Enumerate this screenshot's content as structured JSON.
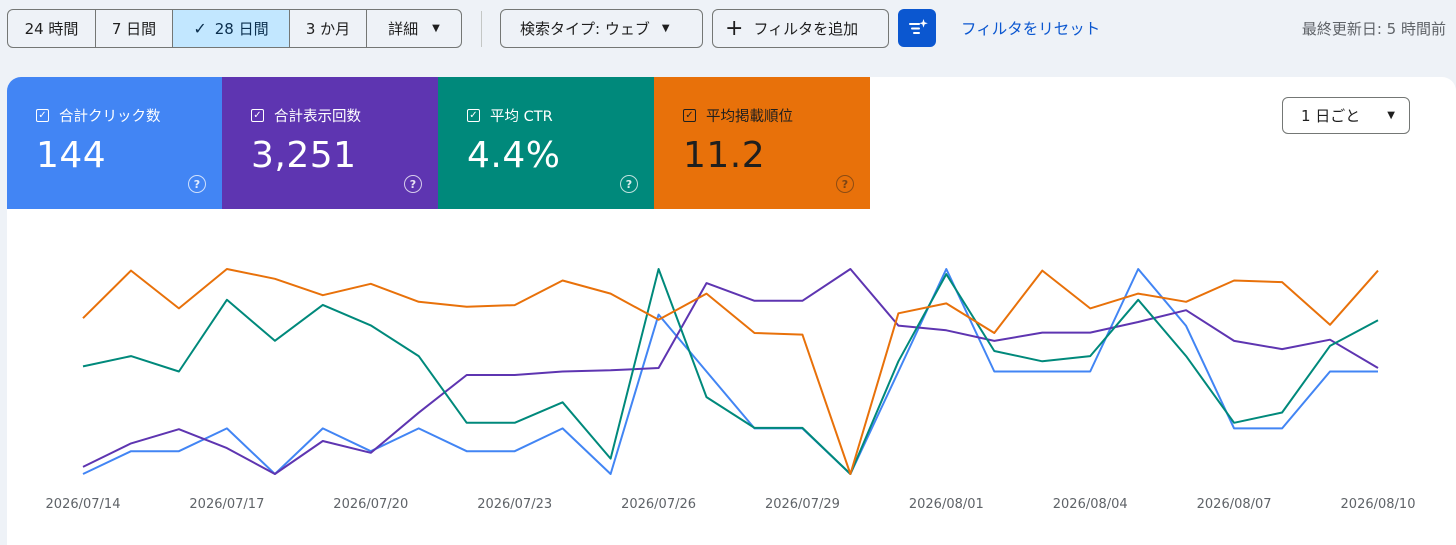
{
  "toolbar": {
    "range_buttons": [
      {
        "label": "24 時間",
        "active": false
      },
      {
        "label": "7 日間",
        "active": false
      },
      {
        "label": "28 日間",
        "active": true
      },
      {
        "label": "3 か月",
        "active": false
      },
      {
        "label": "詳細",
        "active": false
      }
    ],
    "search_type": "検索タイプ: ウェブ",
    "add_filter": "フィルタを追加",
    "reset_filters": "フィルタをリセット",
    "last_updated": "最終更新日: 5 時間前"
  },
  "metrics": [
    {
      "label": "合計クリック数",
      "value": "144",
      "color": "#4285f4",
      "checked": true
    },
    {
      "label": "合計表示回数",
      "value": "3,251",
      "color": "#5e35b1",
      "checked": true
    },
    {
      "label": "平均 CTR",
      "value": "4.4%",
      "color": "#00897b",
      "checked": true
    },
    {
      "label": "平均掲載順位",
      "value": "11.2",
      "color": "#e8710a",
      "checked": true
    }
  ],
  "granularity": {
    "label": "1 日ごと"
  },
  "chart_data": {
    "type": "line",
    "x_tick_labels": [
      "2026/07/14",
      "2026/07/17",
      "2026/07/20",
      "2026/07/23",
      "2026/07/26",
      "2026/07/29",
      "2026/08/01",
      "2026/08/04",
      "2026/08/07",
      "2026/08/10"
    ],
    "x": [
      "2026/07/14",
      "2026/07/15",
      "2026/07/16",
      "2026/07/17",
      "2026/07/18",
      "2026/07/19",
      "2026/07/20",
      "2026/07/21",
      "2026/07/22",
      "2026/07/23",
      "2026/07/24",
      "2026/07/25",
      "2026/07/26",
      "2026/07/27",
      "2026/07/28",
      "2026/07/29",
      "2026/07/30",
      "2026/07/31",
      "2026/08/01",
      "2026/08/02",
      "2026/08/03",
      "2026/08/04",
      "2026/08/05",
      "2026/08/06",
      "2026/08/07",
      "2026/08/08",
      "2026/08/09",
      "2026/08/10"
    ],
    "y_axis_visible": false,
    "grid": false,
    "legend": "none",
    "series": [
      {
        "name": "合計クリック数",
        "color": "#4285f4",
        "values": [
          1,
          3,
          3,
          5,
          1,
          5,
          3,
          5,
          3,
          3,
          5,
          1,
          15,
          10,
          5,
          5,
          1,
          10,
          19,
          10,
          10,
          10,
          19,
          14,
          5,
          5,
          10,
          10
        ]
      },
      {
        "name": "合計表示回数",
        "color": "#5e35b1",
        "values": [
          44,
          64,
          76,
          60,
          38,
          66,
          56,
          90,
          122,
          122,
          125,
          126,
          128,
          200,
          185,
          185,
          212,
          164,
          160,
          151,
          158,
          158,
          167,
          177,
          151,
          144,
          152,
          128
        ]
      },
      {
        "name": "平均 CTR",
        "color": "#00897b",
        "values": [
          2.3,
          2.5,
          2.2,
          3.6,
          2.8,
          3.5,
          3.1,
          2.5,
          1.2,
          1.2,
          1.6,
          0.5,
          4.2,
          1.7,
          1.1,
          1.1,
          0.2,
          2.4,
          4.1,
          2.6,
          2.4,
          2.5,
          3.6,
          2.5,
          1.2,
          1.4,
          2.7,
          3.2
        ]
      },
      {
        "name": "平均掲載順位",
        "color": "#e8710a",
        "values": [
          10.2,
          7.3,
          9.6,
          7.2,
          7.8,
          8.8,
          8.1,
          9.2,
          9.5,
          9.4,
          7.9,
          8.7,
          10.3,
          8.7,
          11.1,
          11.2,
          19.7,
          9.9,
          9.3,
          11.1,
          7.3,
          9.6,
          8.7,
          9.2,
          7.9,
          8.0,
          10.6,
          7.3
        ]
      }
    ]
  }
}
